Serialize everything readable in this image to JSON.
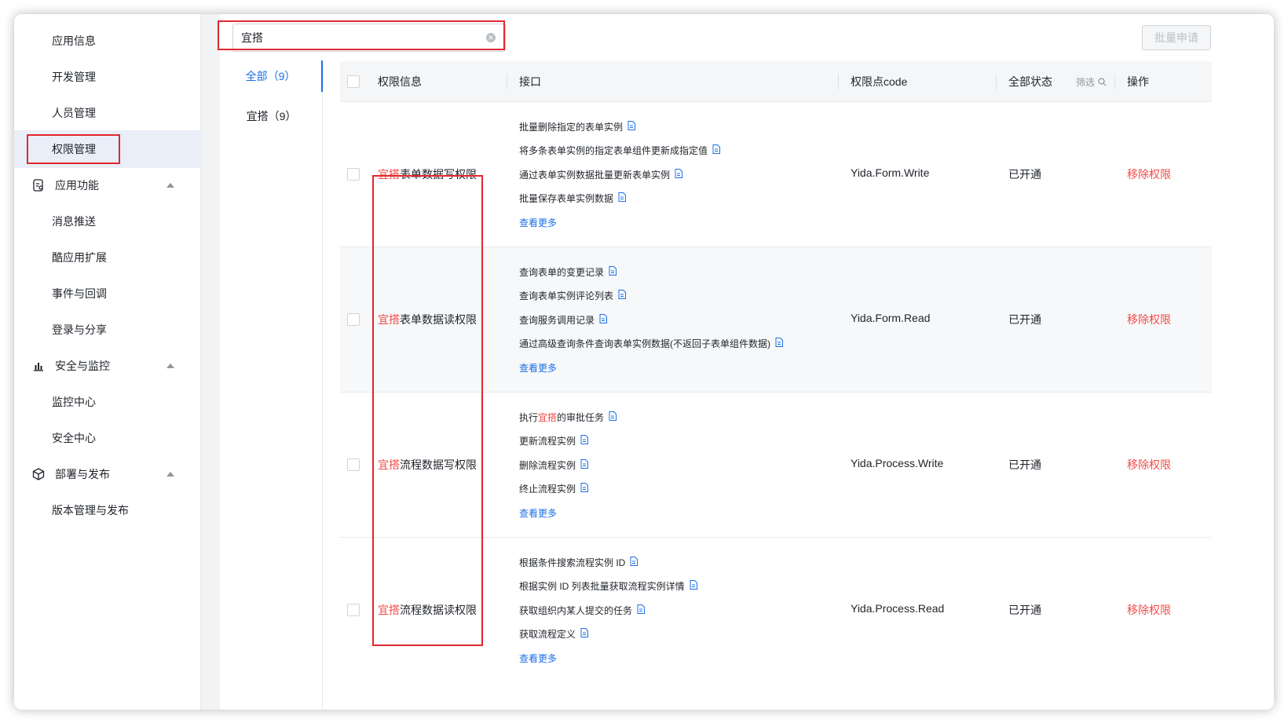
{
  "sidebar": {
    "items": [
      {
        "label": "应用信息"
      },
      {
        "label": "开发管理"
      },
      {
        "label": "人员管理"
      },
      {
        "label": "权限管理",
        "active": true
      },
      {
        "label": "应用功能",
        "group": true,
        "icon": "app-function-icon"
      },
      {
        "label": "消息推送"
      },
      {
        "label": "酷应用扩展"
      },
      {
        "label": "事件与回调"
      },
      {
        "label": "登录与分享"
      },
      {
        "label": "安全与监控",
        "group": true,
        "icon": "chart-icon"
      },
      {
        "label": "监控中心"
      },
      {
        "label": "安全中心"
      },
      {
        "label": "部署与发布",
        "group": true,
        "icon": "cube-icon"
      },
      {
        "label": "版本管理与发布"
      }
    ]
  },
  "search": {
    "value": "宜搭"
  },
  "batch_button": "批量申请",
  "tabs": [
    {
      "label": "全部（9）",
      "active": true
    },
    {
      "label": "宜搭（9）"
    }
  ],
  "table": {
    "headers": {
      "perm_info": "权限信息",
      "api": "接口",
      "code": "权限点code",
      "status": "全部状态",
      "filter": "筛选",
      "action": "操作"
    },
    "rows": [
      {
        "name_prefix": "宜搭",
        "name_suffix": "表单数据写权限",
        "apis": [
          "批量删除指定的表单实例",
          "将多条表单实例的指定表单组件更新成指定值",
          "通过表单实例数据批量更新表单实例",
          "批量保存表单实例数据"
        ],
        "more": "查看更多",
        "code": "Yida.Form.Write",
        "status": "已开通",
        "action": "移除权限"
      },
      {
        "name_prefix": "宜搭",
        "name_suffix": "表单数据读权限",
        "apis": [
          "查询表单的变更记录",
          "查询表单实例评论列表",
          "查询服务调用记录",
          "通过高级查询条件查询表单实例数据(不返回子表单组件数据)"
        ],
        "more": "查看更多",
        "code": "Yida.Form.Read",
        "status": "已开通",
        "action": "移除权限"
      },
      {
        "name_prefix": "宜搭",
        "name_suffix": "流程数据写权限",
        "apis": [
          "执行宜搭的审批任务",
          "更新流程实例",
          "删除流程实例",
          "终止流程实例"
        ],
        "more": "查看更多",
        "code": "Yida.Process.Write",
        "status": "已开通",
        "action": "移除权限"
      },
      {
        "name_prefix": "宜搭",
        "name_suffix": "流程数据读权限",
        "apis": [
          "根据条件搜索流程实例 ID",
          "根据实例 ID 列表批量获取流程实例详情",
          "获取组织内某人提交的任务",
          "获取流程定义"
        ],
        "more": "查看更多",
        "code": "Yida.Process.Read",
        "status": "已开通",
        "action": "移除权限"
      }
    ]
  },
  "colors": {
    "accent": "#1a6fe8",
    "danger": "#f54a45",
    "highlight_box": "#e0282e"
  }
}
